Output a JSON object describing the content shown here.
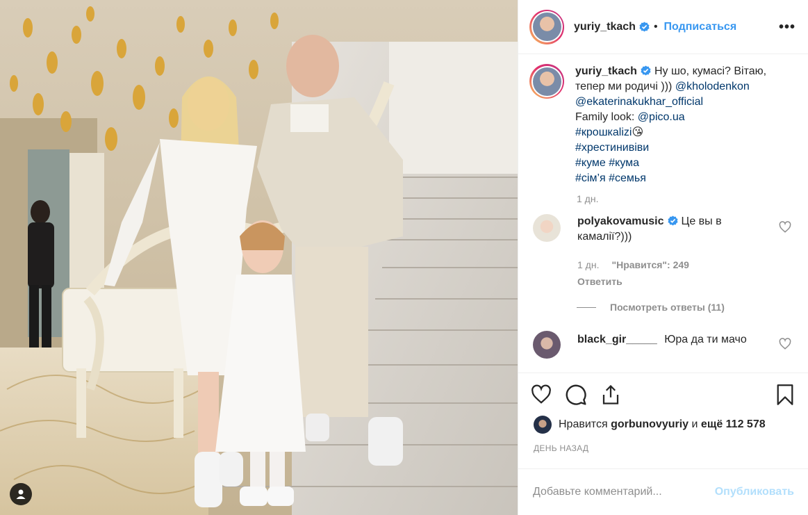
{
  "post": {
    "username": "yuriy_tkach",
    "follow_label": "Подписаться",
    "more_label": "•••",
    "caption_parts": {
      "text1": "Ну шо, кумасі? Вітаю, тепер ми родичі ))) ",
      "mention1": "@kholodenkon",
      "mention2": "@ekaterinakukhar_official",
      "family_label": "Family look: ",
      "mention3": "@pico.ua",
      "tag1": "#крошкаlizi",
      "emoji1": "😘",
      "tag2": "#хрестинивіви",
      "tag3": "#куме",
      "tag4": "#кума",
      "tag5": "#сім’я",
      "tag6": "#семья"
    },
    "caption_time": "1 дн."
  },
  "comments": [
    {
      "username": "polyakovamusic",
      "verified": true,
      "text": "Це вы в камалії?)))",
      "time": "1 дн.",
      "likes": "\"Нравится\": 249",
      "reply_label": "Ответить",
      "view_replies": "Посмотреть ответы (11)"
    },
    {
      "username": "black_gir_____",
      "verified": false,
      "text": "Юра да ти мачо"
    }
  ],
  "likes": {
    "prefix": "Нравится",
    "user": "gorbunovyuriy",
    "middle": "и",
    "count": "ещё 112 578"
  },
  "posted_ago": "ДЕНЬ НАЗАД",
  "add_comment": {
    "placeholder": "Добавьте комментарий...",
    "publish_label": "Опубликовать"
  },
  "colors": {
    "accent": "#3897f0",
    "link": "#00376b",
    "muted": "#8e8e8e",
    "publish_disabled": "#b2dffc"
  },
  "icons": [
    "user-tag-icon",
    "verified-icon",
    "more-options-icon",
    "heart-icon",
    "comment-icon",
    "share-icon",
    "bookmark-icon"
  ]
}
